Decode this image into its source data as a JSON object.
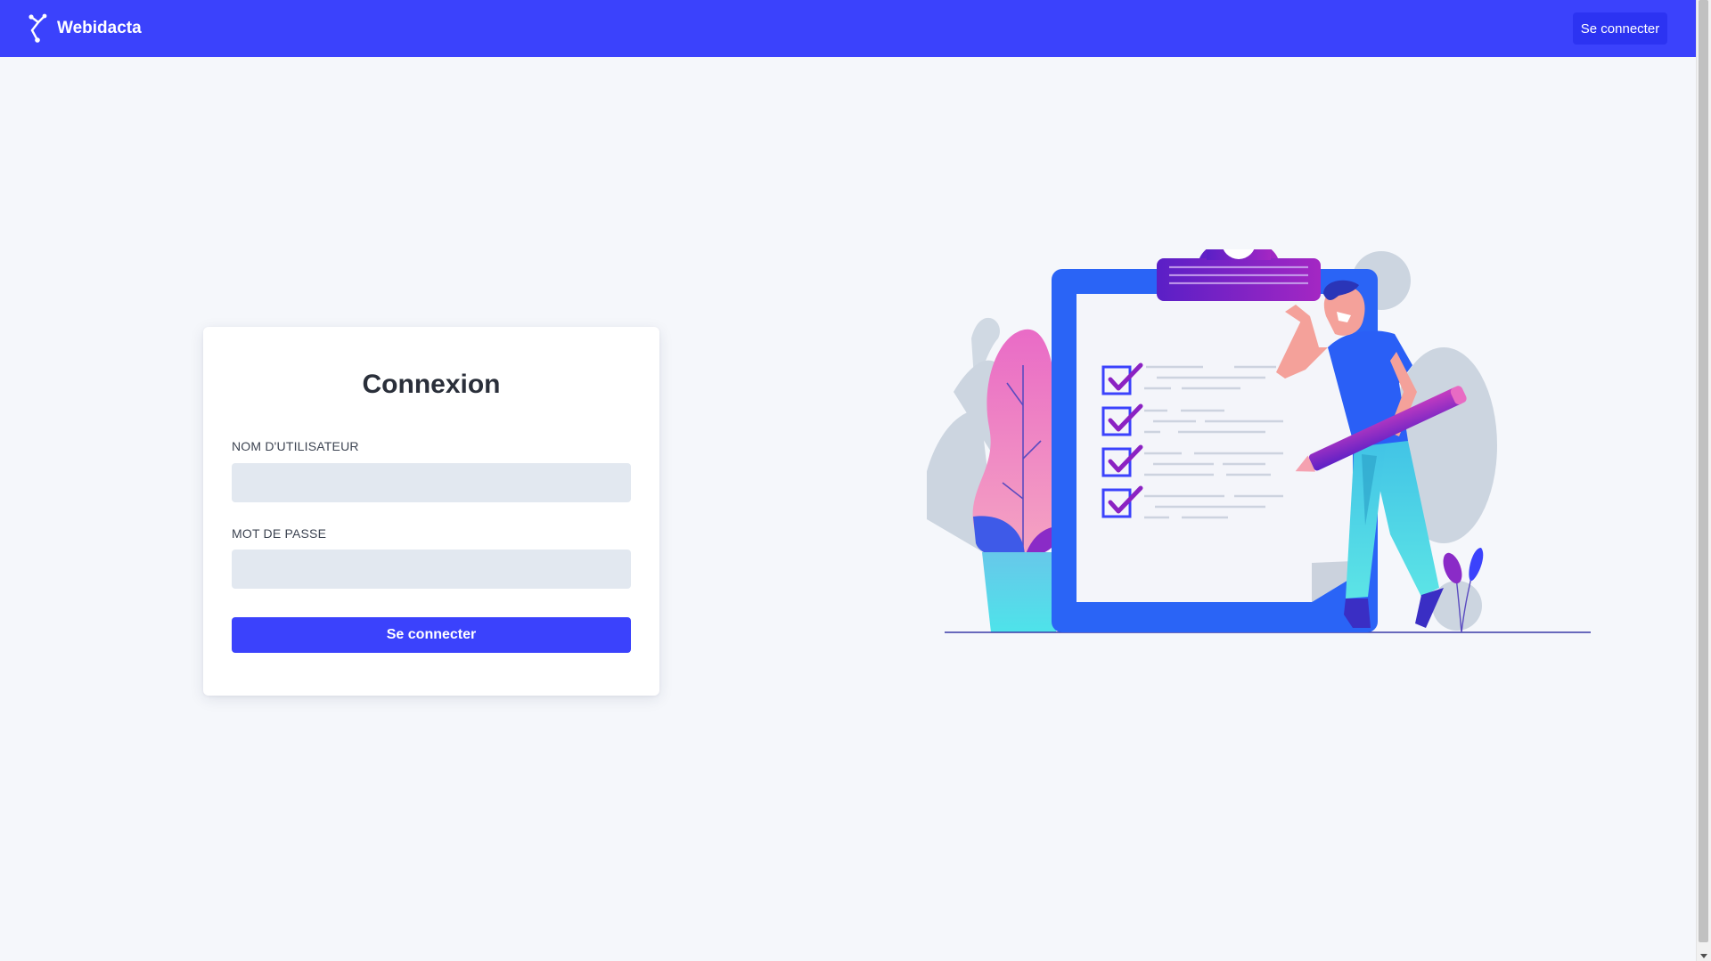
{
  "navbar": {
    "brand_name": "Webidacta",
    "login_label": "Se connecter",
    "logo_icon": "network-node-icon"
  },
  "login_card": {
    "title": "Connexion",
    "username": {
      "label": "NOM D'UTILISATEUR",
      "value": "",
      "placeholder": ""
    },
    "password": {
      "label": "MOT DE PASSE",
      "value": "",
      "placeholder": ""
    },
    "submit_label": "Se connecter"
  },
  "illustration": {
    "subject": "clipboard-checklist-illustration",
    "checklist_items_count": 4
  },
  "colors": {
    "primary": "#3b42fc",
    "background": "#f5f7fb",
    "input_bg": "#e2e8f0",
    "text_dark": "#2a2f3a"
  }
}
